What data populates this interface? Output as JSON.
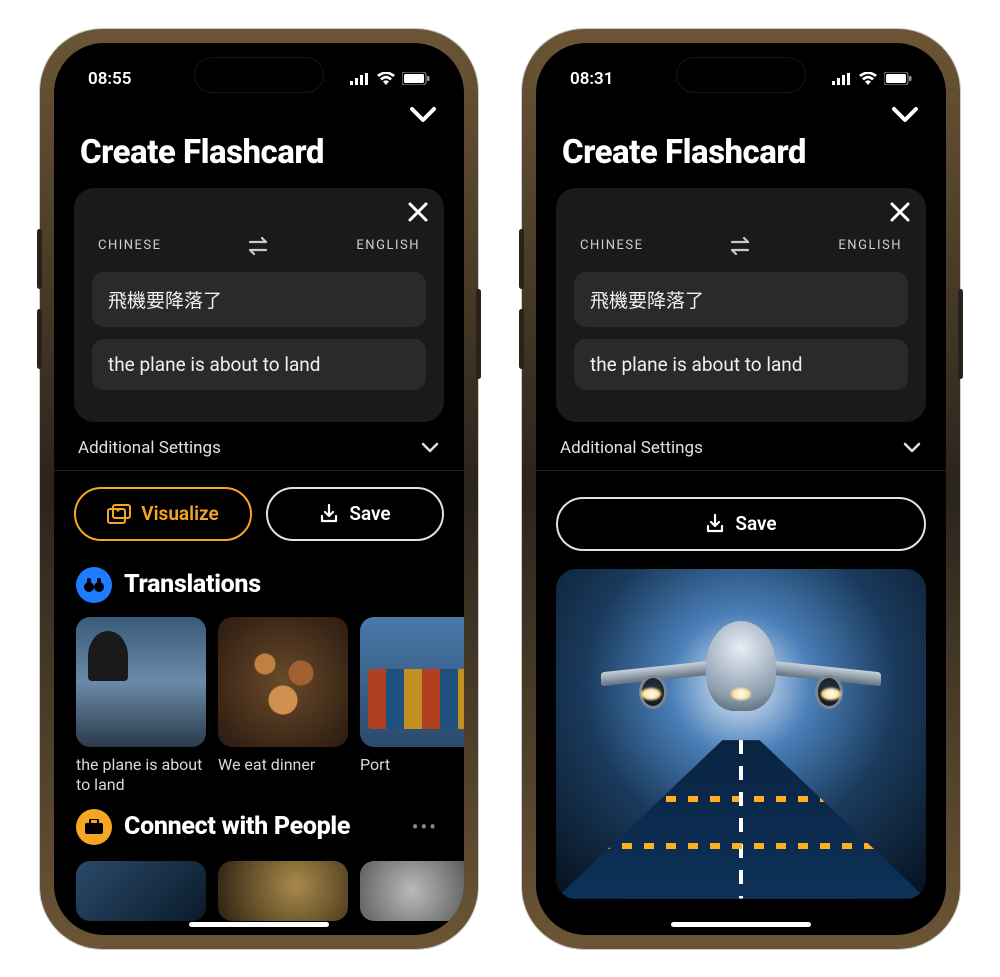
{
  "left": {
    "status_time": "08:55",
    "title": "Create Flashcard",
    "panel": {
      "lang_from": "CHINESE",
      "lang_to": "ENGLISH",
      "source_text": "飛機要降落了",
      "target_text": "the plane is about to land"
    },
    "additional_settings_label": "Additional Settings",
    "visualize_label": "Visualize",
    "save_label": "Save",
    "translations": {
      "heading": "Translations",
      "items": [
        {
          "label": "the plane is about to land"
        },
        {
          "label": "We eat dinner"
        },
        {
          "label": "Port"
        }
      ]
    },
    "connect": {
      "heading": "Connect with People"
    }
  },
  "right": {
    "status_time": "08:31",
    "title": "Create Flashcard",
    "panel": {
      "lang_from": "CHINESE",
      "lang_to": "ENGLISH",
      "source_text": "飛機要降落了",
      "target_text": "the plane is about to land"
    },
    "additional_settings_label": "Additional Settings",
    "save_label": "Save"
  }
}
